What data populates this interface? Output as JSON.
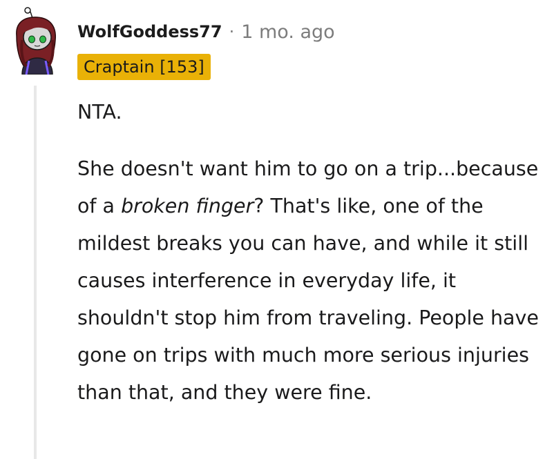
{
  "comment": {
    "author": "WolfGoddess77",
    "separator": "·",
    "timestamp": "1 mo. ago",
    "flair": "Craptain [153]",
    "paragraphs": [
      {
        "text": "NTA."
      },
      {
        "before": "She doesn't want him to go on a trip...because of a ",
        "emphasis": "broken finger",
        "after": "? That's like, one of the mildest breaks you can have, and while it still causes interference in everyday life, it shouldn't stop him from traveling. People have gone on trips with much more serious injuries than that, and they were fine."
      }
    ]
  },
  "colors": {
    "flair_background": "#e9b107",
    "thread_line": "#e8e8e8",
    "meta_text": "#7c7c7c",
    "body_text": "#1a1a1b"
  },
  "icons": {
    "avatar": "snoo-avatar-icon"
  }
}
